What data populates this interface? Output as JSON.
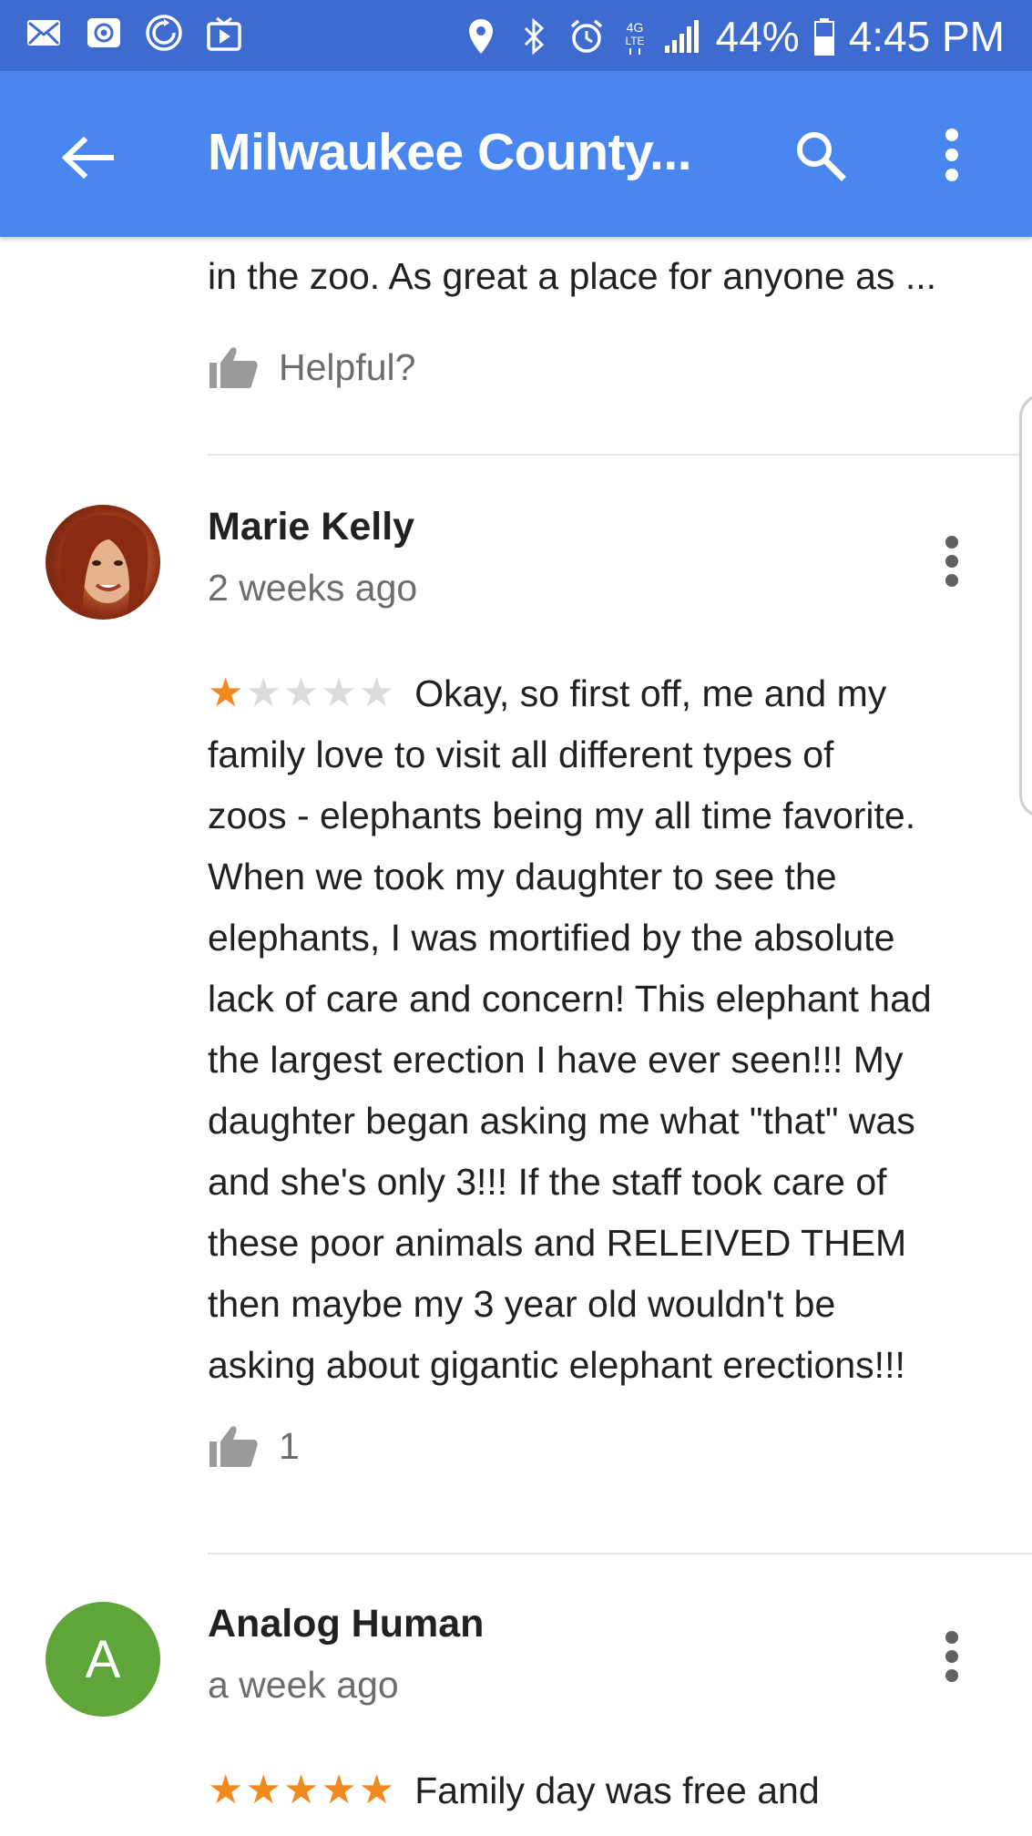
{
  "status_bar": {
    "battery": "44%",
    "time": "4:45 PM",
    "network": "4G LTE"
  },
  "app_bar": {
    "title": "Milwaukee County..."
  },
  "previous_review": {
    "text_tail": "in the zoo. As great a place for anyone as ...",
    "helpful_label": "Helpful?"
  },
  "reviews": [
    {
      "name": "Marie Kelly",
      "time": "2 weeks ago",
      "rating": 1,
      "lines": [
        "Okay, so first off, me and my",
        "family love to visit all different types of",
        "zoos - elephants being my all time favorite.",
        "When we took my daughter to see the",
        "elephants, I was mortified by the absolute",
        "lack of care and concern! This elephant had",
        "the largest erection I have ever seen!!! My",
        "daughter began asking me what \"that\" was",
        "and she's only 3!!! If the staff took care of",
        "these poor animals and RELEIVED THEM",
        "then maybe my 3 year old wouldn't be",
        "asking about gigantic elephant erections!!!"
      ],
      "likes": "1"
    },
    {
      "name": "Analog Human",
      "avatar_letter": "A",
      "time": "a week ago",
      "rating": 5,
      "lines": [
        "Family day was free and"
      ]
    }
  ],
  "colors": {
    "status_bar": "#3e6bd0",
    "app_bar": "#4a86f0",
    "star_on": "#f08a1e",
    "star_off": "#dcdcdc",
    "avatar_green": "#5fa53a"
  }
}
